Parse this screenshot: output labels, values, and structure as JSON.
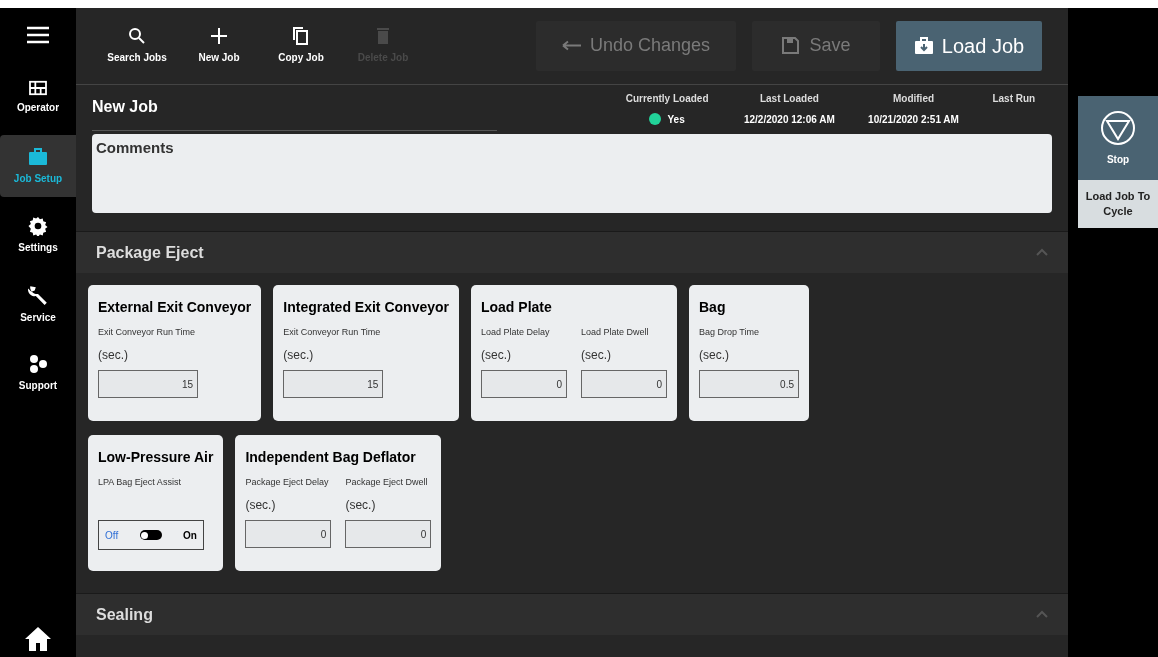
{
  "nav": {
    "items": [
      {
        "kind": "operator",
        "label": "Operator",
        "selected": false
      },
      {
        "kind": "jobsetup",
        "label": "Job Setup",
        "selected": true
      },
      {
        "kind": "settings",
        "label": "Settings",
        "selected": false
      },
      {
        "kind": "service",
        "label": "Service",
        "selected": false
      },
      {
        "kind": "support",
        "label": "Support",
        "selected": false
      }
    ]
  },
  "toolbar": {
    "tools": [
      {
        "kind": "search",
        "label": "Search Jobs",
        "disabled": false
      },
      {
        "kind": "new",
        "label": "New Job",
        "disabled": false
      },
      {
        "kind": "copy",
        "label": "Copy Job",
        "disabled": false
      },
      {
        "kind": "delete",
        "label": "Delete Job",
        "disabled": true
      }
    ],
    "actions": [
      {
        "kind": "undo",
        "label": "Undo Changes",
        "disabled": true
      },
      {
        "kind": "save",
        "label": "Save",
        "disabled": true
      },
      {
        "kind": "load",
        "label": "Load Job",
        "disabled": false
      }
    ]
  },
  "job": {
    "title": "New Job",
    "info": [
      {
        "label": "Currently Loaded",
        "value": "Yes",
        "color": "#22d39a"
      },
      {
        "label": "Last Loaded",
        "value": "12/2/2020 12:06 AM"
      },
      {
        "label": "Modified",
        "value": "10/21/2020 2:51 AM"
      },
      {
        "label": "Last Run"
      }
    ],
    "comments_label": "Comments"
  },
  "sections": [
    {
      "title": "Package Eject",
      "expanded": true,
      "cards": [
        {
          "title": "External Exit Conveyor",
          "fields": [
            {
              "kind": "number",
              "label": "Exit Conveyor Run Time",
              "unit": "(sec.)",
              "value": "15"
            }
          ]
        },
        {
          "title": "Integrated Exit Conveyor",
          "fields": [
            {
              "kind": "number",
              "label": "Exit Conveyor Run Time",
              "unit": "(sec.)",
              "value": "15"
            }
          ]
        },
        {
          "title": "Load Plate",
          "fields": [
            {
              "kind": "number",
              "label": "Load Plate Delay",
              "unit": "(sec.)",
              "value": "0"
            },
            {
              "kind": "number",
              "label": "Load Plate Dwell",
              "unit": "(sec.)",
              "value": "0"
            }
          ]
        },
        {
          "title": "Bag",
          "fields": [
            {
              "kind": "number",
              "label": "Bag Drop Time",
              "unit": "(sec.)",
              "value": "0.5"
            }
          ]
        },
        {
          "title": "Low-Pressure Air",
          "fields": [
            {
              "kind": "toggle",
              "label": "LPA Bag Eject Assist",
              "off_label": "Off",
              "on_label": "On",
              "on": false
            }
          ]
        },
        {
          "title": "Independent Bag Deflator",
          "fields": [
            {
              "kind": "number",
              "label": "Package Eject Delay",
              "unit": "(sec.)",
              "value": "0"
            },
            {
              "kind": "number",
              "label": "Package Eject Dwell",
              "unit": "(sec.)",
              "value": "0"
            }
          ]
        }
      ]
    },
    {
      "title": "Sealing",
      "expanded": true
    }
  ],
  "side_panel": {
    "buttons": [
      {
        "kind": "stop",
        "label": "Stop"
      },
      {
        "kind": "cycle",
        "label": "Load Job To Cycle"
      }
    ]
  }
}
